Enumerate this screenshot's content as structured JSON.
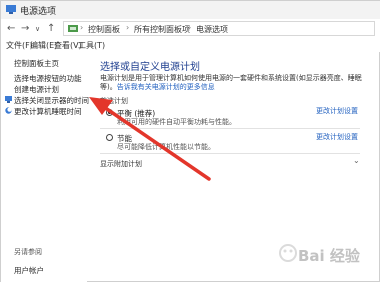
{
  "window": {
    "title": "电源选项"
  },
  "nav": {
    "back": "←",
    "forward": "→",
    "recent": "∨",
    "up": "↑"
  },
  "breadcrumb": [
    "控制面板",
    "所有控制面板项",
    "电源选项"
  ],
  "menu": [
    "文件(F)",
    "编辑(E)",
    "查看(V)",
    "工具(T)"
  ],
  "sidebar": {
    "items": [
      "控制面板主页",
      "选择电源按钮的功能",
      "创建电源计划",
      "选择关闭显示器的时间",
      "更改计算机睡眠时间"
    ],
    "see_also": "另请参阅",
    "user_accounts": "用户帐户"
  },
  "main": {
    "heading": "选择或自定义电源计划",
    "desc_text": "电源计划是用于管理计算机如何使用电源的一套硬件和系统设置(如显示器亮度、睡眠等)。",
    "desc_link": "告诉我有关电源计划的更多信息",
    "section_title": "首选计划",
    "plans": [
      {
        "name": "平衡 (推荐)",
        "desc": "利用可用的硬件自动平衡功耗与性能。",
        "link": "更改计划设置",
        "selected": true
      },
      {
        "name": "节能",
        "desc": "尽可能降低计算机性能以节能。",
        "link": "更改计划设置",
        "selected": false
      }
    ],
    "show_more": "显示附加计划"
  },
  "colors": {
    "accent": "#1f3f8f",
    "link": "#1f5fbf",
    "arrow": "#e3362b"
  },
  "watermark": "Bai 经验"
}
